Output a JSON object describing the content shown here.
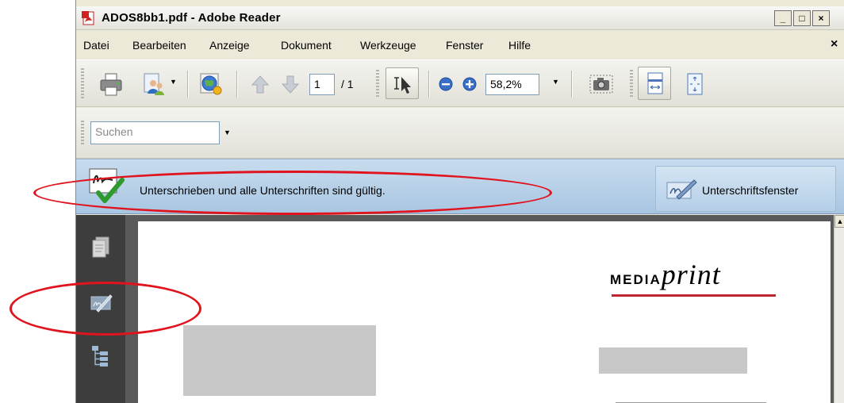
{
  "window": {
    "title": "ADOS8bb1.pdf - Adobe Reader",
    "minimize_label": "_",
    "maximize_label": "□",
    "close_label": "×"
  },
  "menu": {
    "items": [
      "Datei",
      "Bearbeiten",
      "Anzeige",
      "Dokument",
      "Werkzeuge",
      "Fenster",
      "Hilfe"
    ],
    "close_label": "×"
  },
  "toolbar": {
    "page_current": "1",
    "page_total": "/ 1",
    "zoom": "58,2%"
  },
  "search": {
    "placeholder": "Suchen"
  },
  "signature": {
    "status_text": "Unterschrieben und alle Unterschriften sind gültig.",
    "panel_button": "Unterschriftsfenster"
  },
  "document": {
    "logo_media": "MEDIA",
    "logo_print": "print",
    "logo_color": "#c0242f"
  },
  "colors": {
    "annotation": "#e0141e",
    "signature_bar": "#b8d1e8",
    "nav_pane": "#3d3d3d"
  }
}
